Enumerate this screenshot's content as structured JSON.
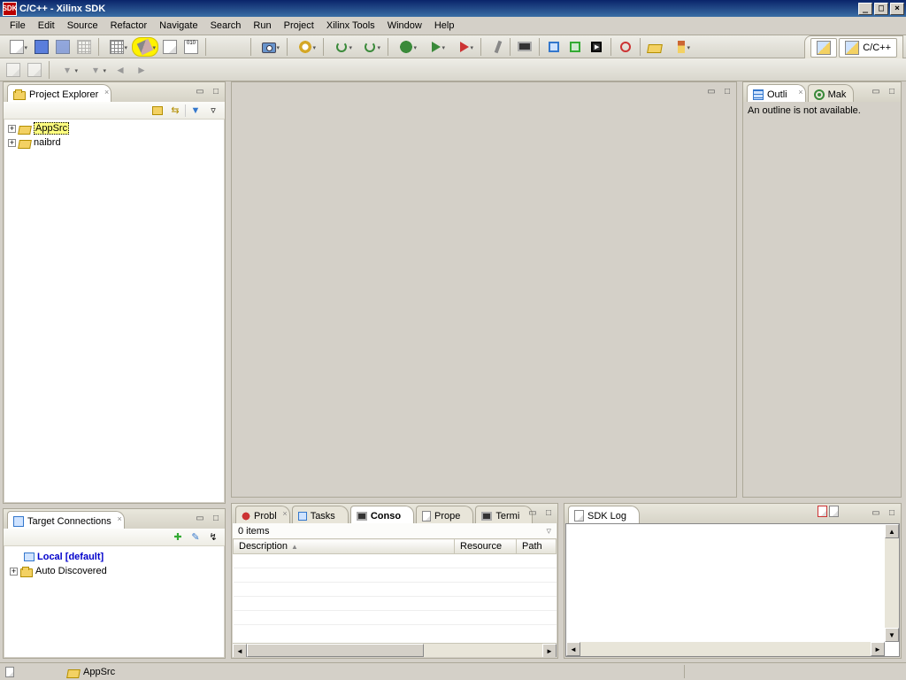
{
  "window": {
    "title": "C/C++ - Xilinx SDK",
    "icon_label": "SDK"
  },
  "menu": [
    "File",
    "Edit",
    "Source",
    "Refactor",
    "Navigate",
    "Search",
    "Run",
    "Project",
    "Xilinx Tools",
    "Window",
    "Help"
  ],
  "perspective": {
    "current": "C/C++"
  },
  "project_explorer": {
    "title": "Project Explorer",
    "items": [
      {
        "label": "AppSrc",
        "selected": true
      },
      {
        "label": "naibrd",
        "selected": false
      }
    ]
  },
  "target_connections": {
    "title": "Target Connections",
    "items": [
      {
        "label": "Local [default]",
        "bold": true,
        "color": "#0000cc",
        "expandable": false
      },
      {
        "label": "Auto Discovered",
        "bold": false,
        "color": "#000",
        "expandable": true
      }
    ]
  },
  "outline": {
    "tab1": "Outli",
    "tab2": "Mak",
    "message": "An outline is not available."
  },
  "bottom_tabs": {
    "tabs": [
      "Probl",
      "Tasks",
      "Conso",
      "Prope",
      "Termi"
    ],
    "active_index": 2,
    "problems_count": "0 items",
    "columns": [
      "Description",
      "Resource",
      "Path"
    ]
  },
  "sdk_log": {
    "title": "SDK Log"
  },
  "status": {
    "selected": "AppSrc"
  }
}
